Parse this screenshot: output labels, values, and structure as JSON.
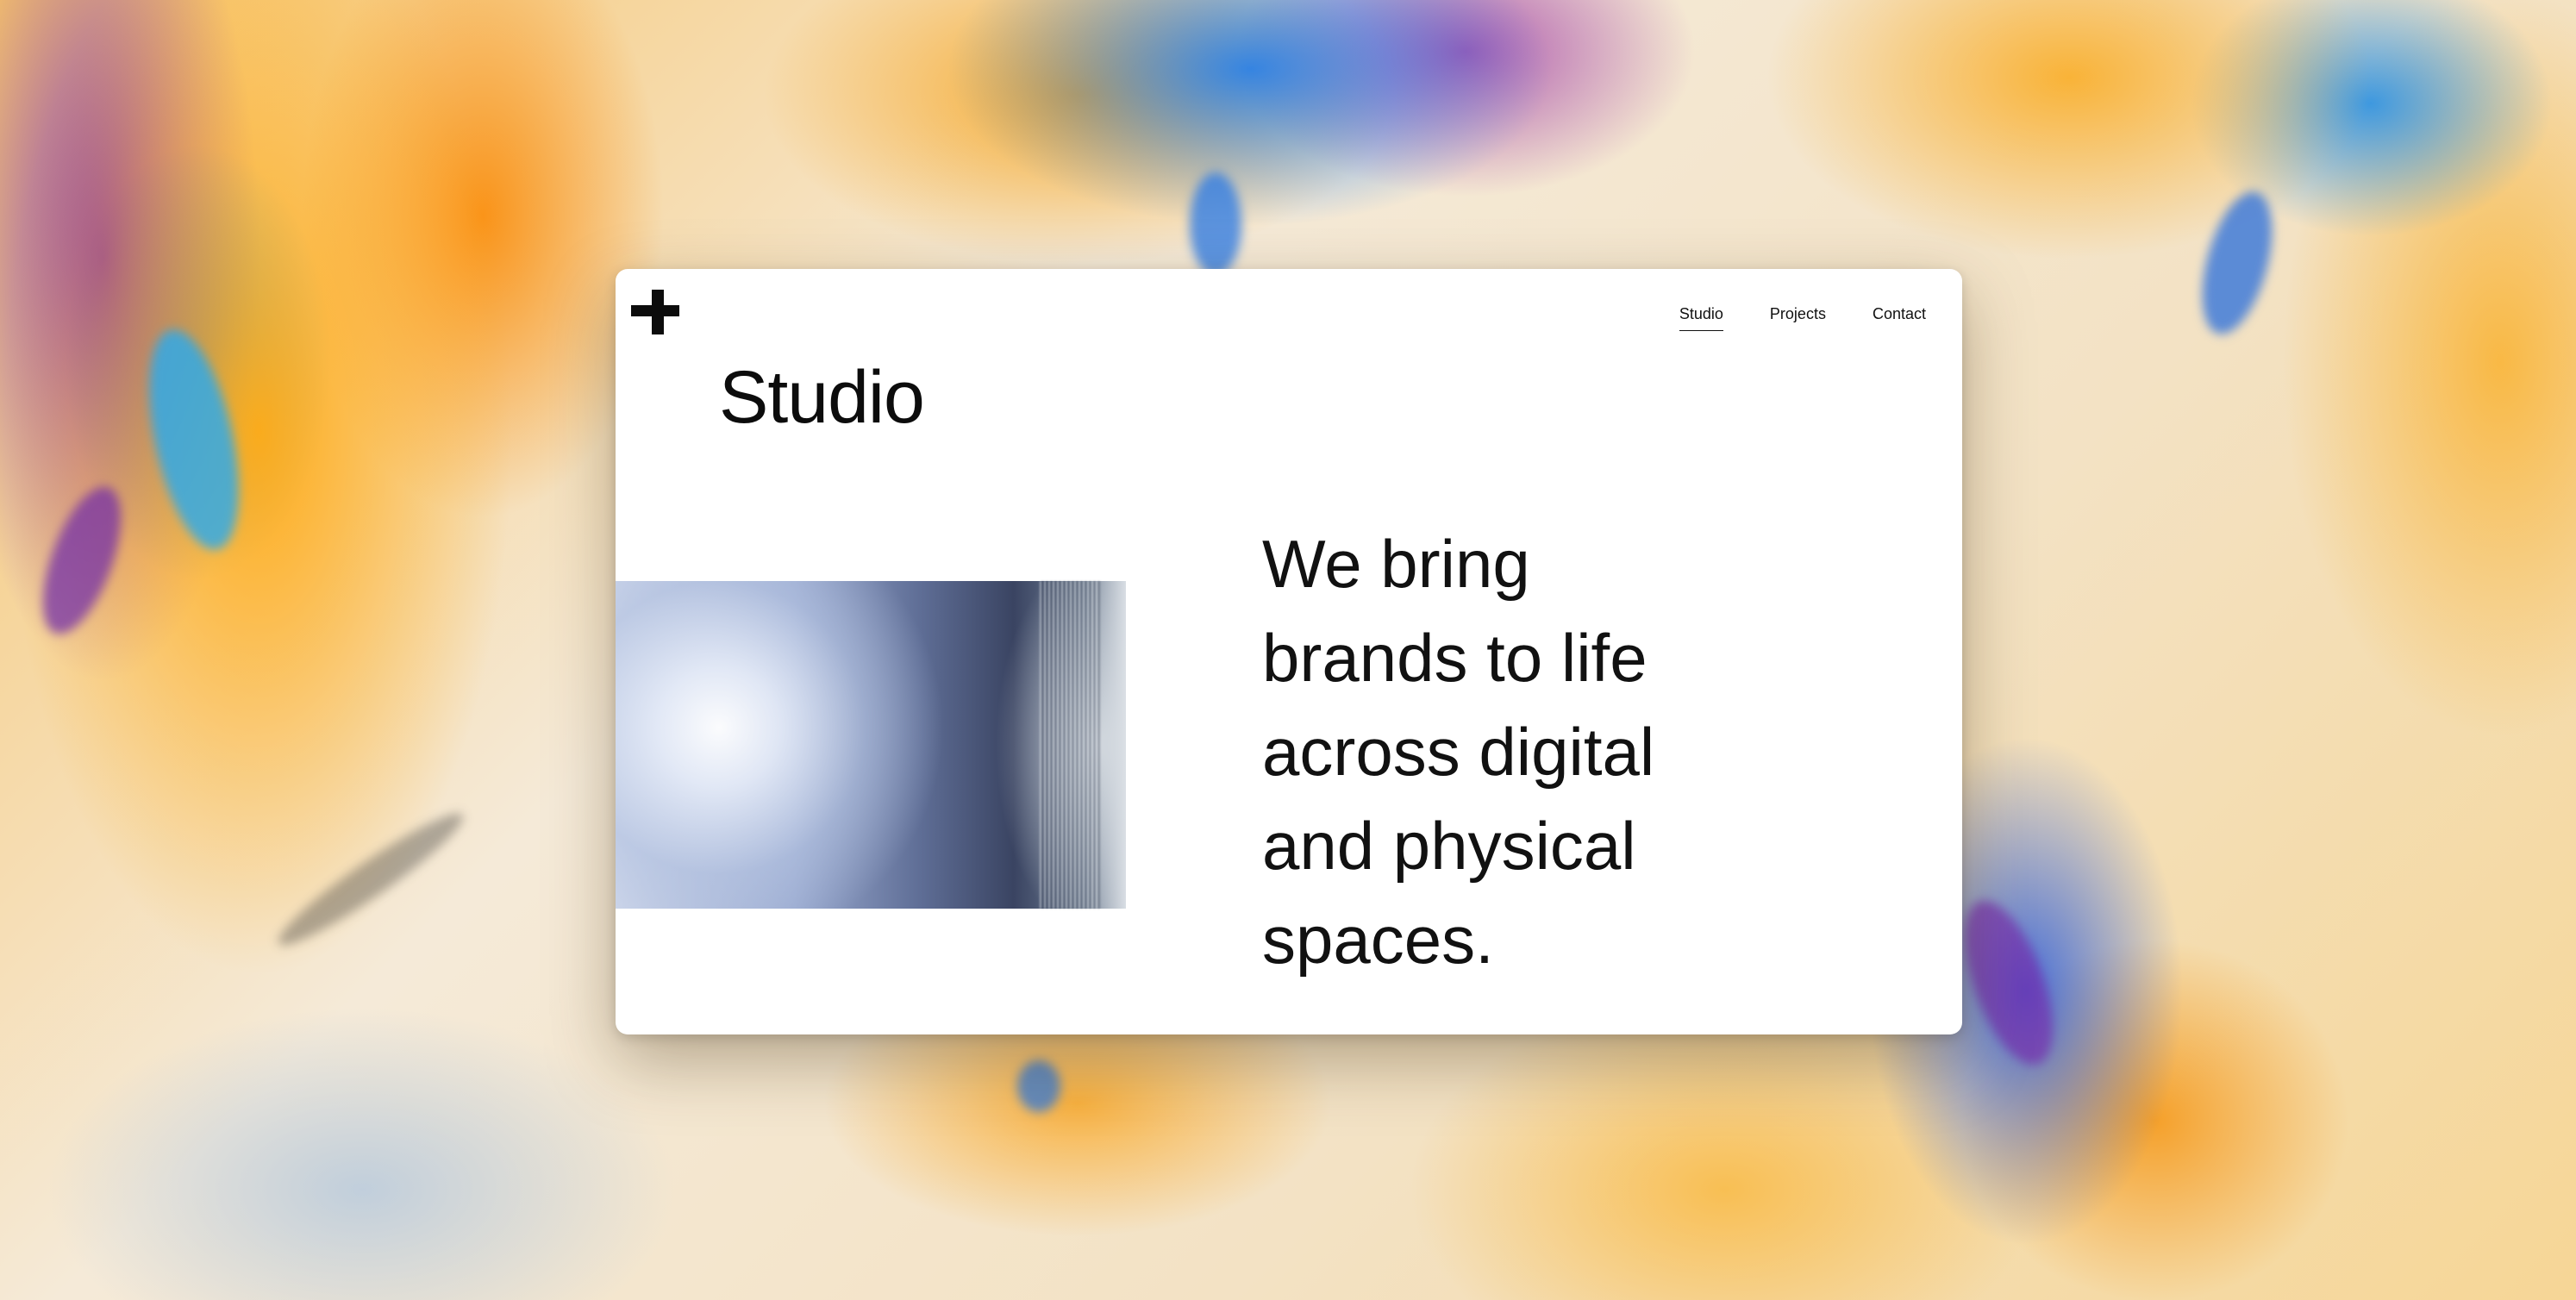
{
  "nav": {
    "items": [
      {
        "label": "Studio",
        "active": true
      },
      {
        "label": "Projects",
        "active": false
      },
      {
        "label": "Contact",
        "active": false
      }
    ]
  },
  "main": {
    "title": "Studio",
    "tagline": "We bring brands to life across digital and physical spaces."
  },
  "colors": {
    "text": "#111111",
    "card_background": "#ffffff"
  },
  "icons": {
    "logo": "plus-logo-icon"
  }
}
